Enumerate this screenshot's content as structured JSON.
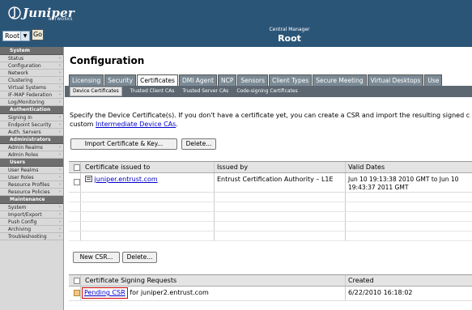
{
  "header": {
    "logo_text": "Juniper",
    "logo_sub": "NETWORKS",
    "root_select_value": "Root",
    "go_label": "Go",
    "central_manager_label": "Central Manager",
    "central_manager_value": "Root"
  },
  "sidebar": {
    "sections": [
      {
        "title": "System",
        "items": [
          "Status",
          "Configuration",
          "Network",
          "Clustering",
          "Virtual Systems",
          "IF-MAP Federation",
          "Log/Monitoring"
        ]
      },
      {
        "title": "Authentication",
        "items": [
          "Signing In",
          "Endpoint Security",
          "Auth. Servers"
        ]
      },
      {
        "title": "Administrators",
        "items": [
          "Admin Realms",
          "Admin Roles"
        ]
      },
      {
        "title": "Users",
        "items": [
          "User Realms",
          "User Roles",
          "Resource Profiles",
          "Resource Policies"
        ]
      },
      {
        "title": "Maintenance",
        "items": [
          "System",
          "Import/Export",
          "Push Config",
          "Archiving",
          "Troubleshooting"
        ]
      }
    ]
  },
  "main": {
    "title": "Configuration",
    "tabs": [
      "Licensing",
      "Security",
      "Certificates",
      "DMI Agent",
      "NCP",
      "Sensors",
      "Client Types",
      "Secure Meeting",
      "Virtual Desktops",
      "Use"
    ],
    "active_tab": "Certificates",
    "subtabs": [
      "Device Certificates",
      "Trusted Client CAs",
      "Trusted Server CAs",
      "Code-signing Certificates"
    ],
    "active_subtab": "Device Certificates",
    "description_line1": "Specify the Device Certificate(s). If you don't have a certificate yet, you can create a CSR and import the resulting signed c",
    "description_line2_prefix": "custom ",
    "description_link": "Intermediate Device CAs",
    "description_line2_suffix": ".",
    "import_button": "Import Certificate & Key...",
    "delete_button": "Delete...",
    "cert_table": {
      "headers": [
        "Certificate issued to",
        "Issued by",
        "Valid Dates"
      ],
      "rows": [
        {
          "issued_to": "juniper.entrust.com",
          "issued_by": "Entrust Certification Authority – L1E",
          "valid_line1": "Jun 10 19:13:38 2010 GMT to Jun 10",
          "valid_line2": "19:43:37 2011 GMT"
        }
      ]
    },
    "new_csr_button": "New CSR...",
    "csr_delete_button": "Delete...",
    "csr_table": {
      "headers": [
        "Certificate Signing Requests",
        "Created"
      ],
      "rows": [
        {
          "link": "Pending CSR",
          "text": " for juniper2.entrust.com",
          "created": "6/22/2010 16:18:02"
        }
      ]
    }
  },
  "colors": {
    "header_bg": "#2b5577",
    "sidebar_header_bg": "#6e6e6e",
    "tab_bg": "#7b8a95",
    "subtab_bar_bg": "#5c6771",
    "pending_csr_highlight": "#cc0000"
  }
}
